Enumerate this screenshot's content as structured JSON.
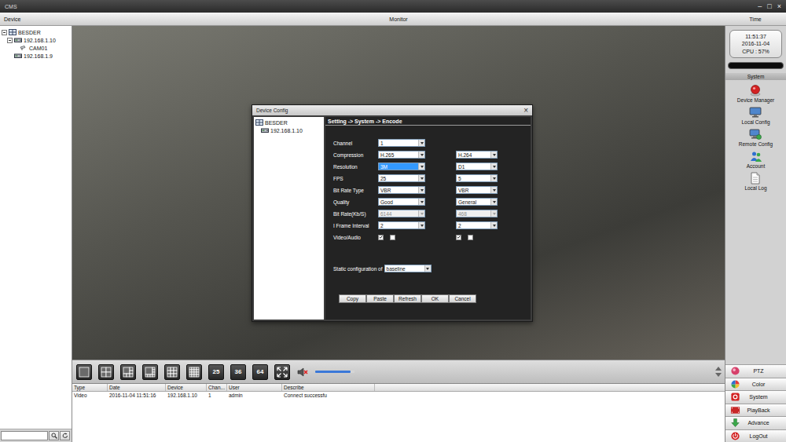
{
  "window": {
    "title": "CMS",
    "controls": [
      "–",
      "□",
      "×"
    ]
  },
  "header": {
    "left": "Device",
    "center": "Monitor",
    "right": "Time"
  },
  "device_tree": [
    {
      "label": "BESDER",
      "kind": "group",
      "expanded": true,
      "children": [
        {
          "label": "192.168.1.10",
          "kind": "device",
          "expanded": true,
          "children": [
            {
              "label": "CAM01",
              "kind": "camera",
              "expanded": false,
              "children": []
            }
          ]
        },
        {
          "label": "192.168.1.9",
          "kind": "device",
          "expanded": false,
          "children": []
        }
      ]
    }
  ],
  "search": {
    "value": ""
  },
  "dialog": {
    "title": "Device Config",
    "close": "×",
    "tree": [
      {
        "label": "BESDER",
        "kind": "group",
        "expanded": true,
        "children": [
          {
            "label": "192.168.1.10",
            "kind": "device",
            "expanded": false,
            "children": []
          }
        ]
      }
    ],
    "breadcrumb": "Setting -> System -> Encode",
    "rows": [
      {
        "label": "Channel",
        "kind": "select",
        "fields": [
          {
            "value": "1",
            "selected": false,
            "disabled": false
          }
        ]
      },
      {
        "label": "Compression",
        "kind": "select",
        "fields": [
          {
            "value": "H.265",
            "selected": false,
            "disabled": false
          },
          {
            "value": "H.264",
            "selected": false,
            "disabled": false
          }
        ]
      },
      {
        "label": "Resolution",
        "kind": "select",
        "fields": [
          {
            "value": "3M",
            "selected": true,
            "disabled": false
          },
          {
            "value": "D1",
            "selected": false,
            "disabled": false
          }
        ]
      },
      {
        "label": "FPS",
        "kind": "select",
        "fields": [
          {
            "value": "25",
            "selected": false,
            "disabled": false
          },
          {
            "value": "5",
            "selected": false,
            "disabled": false
          }
        ]
      },
      {
        "label": "Bit Rate Type",
        "kind": "select",
        "fields": [
          {
            "value": "VBR",
            "selected": false,
            "disabled": false
          },
          {
            "value": "VBR",
            "selected": false,
            "disabled": false
          }
        ]
      },
      {
        "label": "Quality",
        "kind": "select",
        "fields": [
          {
            "value": "Good",
            "selected": false,
            "disabled": false
          },
          {
            "value": "General",
            "selected": false,
            "disabled": false
          }
        ]
      },
      {
        "label": "Bit Rate(Kb/S)",
        "kind": "select",
        "fields": [
          {
            "value": "6144",
            "selected": false,
            "disabled": true
          },
          {
            "value": "468",
            "selected": false,
            "disabled": true
          }
        ]
      },
      {
        "label": "I Frame Interval",
        "kind": "select",
        "fields": [
          {
            "value": "2",
            "selected": false,
            "disabled": false
          },
          {
            "value": "2",
            "selected": false,
            "disabled": false
          }
        ]
      },
      {
        "label": "Video/Audio",
        "kind": "checks",
        "fields": [
          {
            "checks": [
              true,
              false
            ]
          },
          {
            "checks": [
              true,
              false
            ]
          }
        ]
      }
    ],
    "static": {
      "label": "Static configuration of",
      "value": "baseline"
    },
    "buttons": [
      "Copy",
      "Paste",
      "Refresh",
      "OK",
      "Cancel"
    ]
  },
  "split_buttons": [
    {
      "kind": "single"
    },
    {
      "kind": "quad"
    },
    {
      "kind": "six"
    },
    {
      "kind": "eight"
    },
    {
      "kind": "nine"
    },
    {
      "kind": "sixteen"
    },
    {
      "kind": "text",
      "label": "25"
    },
    {
      "kind": "text",
      "label": "36"
    },
    {
      "kind": "text",
      "label": "64"
    }
  ],
  "volume": {
    "muted": true,
    "level": 0.9
  },
  "log_table": {
    "columns": [
      "Type",
      "Date",
      "Device",
      "Chan...",
      "User",
      "Describe"
    ],
    "rows": [
      [
        "Video",
        "2016-11-04 11:51:16",
        "192.168.1.10",
        "1",
        "admin",
        "Connect successfu"
      ]
    ]
  },
  "status": {
    "time": "11:51:37",
    "date": "2016-11-04",
    "cpu": "CPU : 57%"
  },
  "system_panel": {
    "title": "System",
    "items": [
      {
        "label": "Device Manager",
        "kind": "manager"
      },
      {
        "label": "Local Config",
        "kind": "local"
      },
      {
        "label": "Remote Config",
        "kind": "remote"
      },
      {
        "label": "Account",
        "kind": "account"
      },
      {
        "label": "Local Log",
        "kind": "log"
      }
    ]
  },
  "bottom_buttons": [
    {
      "label": "PTZ",
      "kind": "ptz"
    },
    {
      "label": "Color",
      "kind": "color"
    },
    {
      "label": "System",
      "kind": "system"
    },
    {
      "label": "PlayBack",
      "kind": "playback"
    },
    {
      "label": "Advance",
      "kind": "advance"
    },
    {
      "label": "LogOut",
      "kind": "logout"
    }
  ]
}
